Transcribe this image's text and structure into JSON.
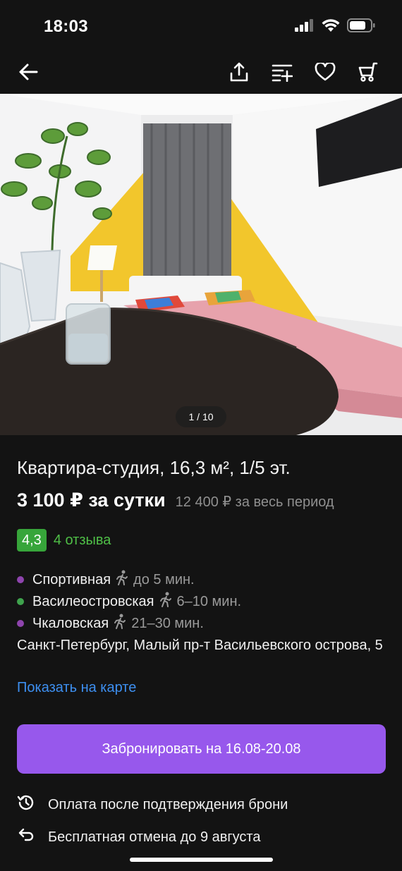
{
  "status": {
    "time": "18:03"
  },
  "nav": {
    "icons": [
      "back-arrow-icon",
      "share-icon",
      "compare-icon",
      "heart-icon",
      "cart-icon"
    ]
  },
  "gallery": {
    "counter": "1 / 10"
  },
  "listing": {
    "title": "Квартира-студия, 16,3 м², 1/5 эт.",
    "price": "3 100 ₽ за сутки",
    "price_total": "12 400 ₽ за весь период",
    "rating": "4,3",
    "reviews": "4 отзыва"
  },
  "metro": [
    {
      "name": "Спортивная",
      "time": "до 5 мин.",
      "color": "#8e44ad"
    },
    {
      "name": "Василеостровская",
      "time": "6–10 мин.",
      "color": "#3fa34d"
    },
    {
      "name": "Чкаловская",
      "time": "21–30 мин.",
      "color": "#8e44ad"
    }
  ],
  "address": "Санкт-Петербург, Малый пр-т Васильевского острова, 5",
  "map_link": "Показать на карте",
  "book_button": "Забронировать на 16.08-20.08",
  "info": {
    "payment": "Оплата после подтверждения брони",
    "cancel": "Бесплатная отмена до 9 августа"
  },
  "colors": {
    "accent": "#9758ec",
    "rating_badge": "#37a53a",
    "link": "#3d8ff0",
    "background": "#131313"
  }
}
